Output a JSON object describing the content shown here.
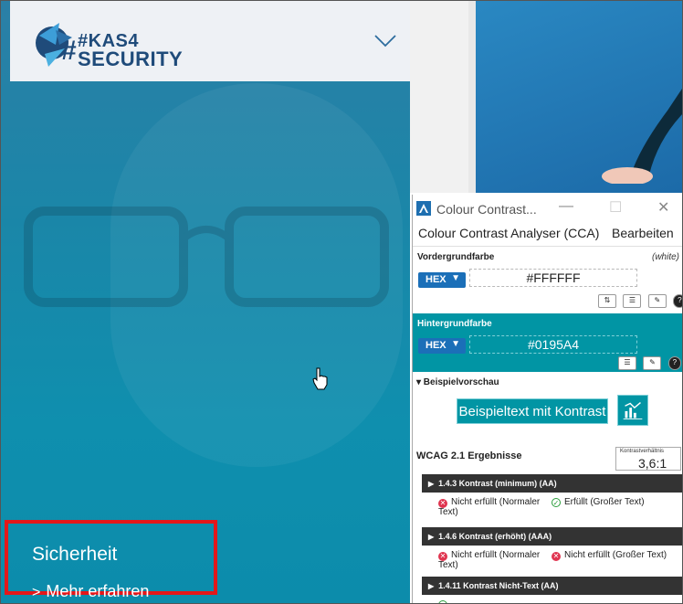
{
  "site": {
    "logo": {
      "line1": "#KAS4",
      "line2": "SECURITY"
    },
    "hero": {
      "title": "Sicherheit",
      "link_label": "Mehr erfahren",
      "link_arrow": ">"
    }
  },
  "cca": {
    "window_title": "Colour Contrast...",
    "window_controls": {
      "minimize": "—",
      "maximize": "☐",
      "close": "✕"
    },
    "menu": {
      "app": "Colour Contrast Analyser (CCA)",
      "edit": "Bearbeiten"
    },
    "foreground": {
      "label": "Vordergrundfarbe",
      "name_hint": "(white)",
      "format": "HEX",
      "value": "#FFFFFF",
      "color": "#FFFFFF"
    },
    "background": {
      "label": "Hintergrundfarbe",
      "format": "HEX",
      "value": "#0195A4",
      "color": "#0195A4"
    },
    "preview": {
      "heading": "▾ Beispielvorschau",
      "sample_text": "Beispieltext mit Kontrast"
    },
    "results": {
      "heading": "WCAG 2.1 Ergebnisse",
      "ratio_label": "Kontrastverhältnis",
      "ratio_value": "3,6:1",
      "criteria": [
        {
          "title": "1.4.3 Kontrast (minimum) (AA)",
          "normal": {
            "status": "fail",
            "text": "Nicht erfüllt (Normaler Text)"
          },
          "large": {
            "status": "pass",
            "text": "Erfüllt (Großer Text)"
          }
        },
        {
          "title": "1.4.6 Kontrast (erhöht) (AAA)",
          "normal": {
            "status": "fail",
            "text": "Nicht erfüllt (Normaler Text)"
          },
          "large": {
            "status": "fail",
            "text": "Nicht erfüllt (Großer Text)"
          }
        },
        {
          "title": "1.4.11 Kontrast Nicht-Text (AA)"
        }
      ]
    }
  },
  "colors": {
    "accent_teal": "#0195A4",
    "highlight_red": "#E3171A",
    "fail_red": "#E0344F",
    "pass_green": "#2A9D3B",
    "logo_blue": "#1F4B7A"
  }
}
